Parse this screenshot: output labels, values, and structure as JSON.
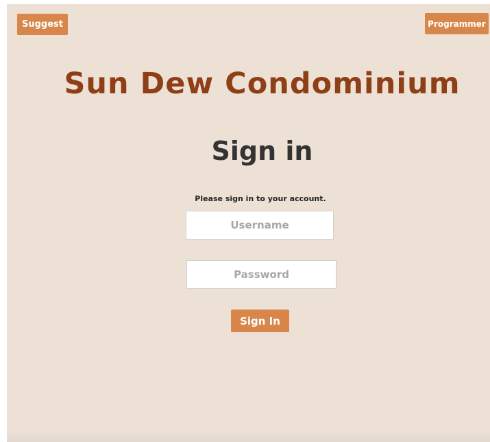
{
  "header": {
    "suggest_label": "Suggest",
    "programmer_label": "Programmer"
  },
  "site": {
    "title": "Sun Dew Condominium"
  },
  "signin": {
    "heading": "Sign in",
    "instruction": "Please sign in to your account.",
    "username_placeholder": "Username",
    "username_value": "",
    "password_placeholder": "Password",
    "password_value": "",
    "submit_label": "Sign In"
  },
  "colors": {
    "background": "#ede1d6",
    "accent": "#d9864a",
    "title": "#8f3f16",
    "heading": "#333333"
  }
}
